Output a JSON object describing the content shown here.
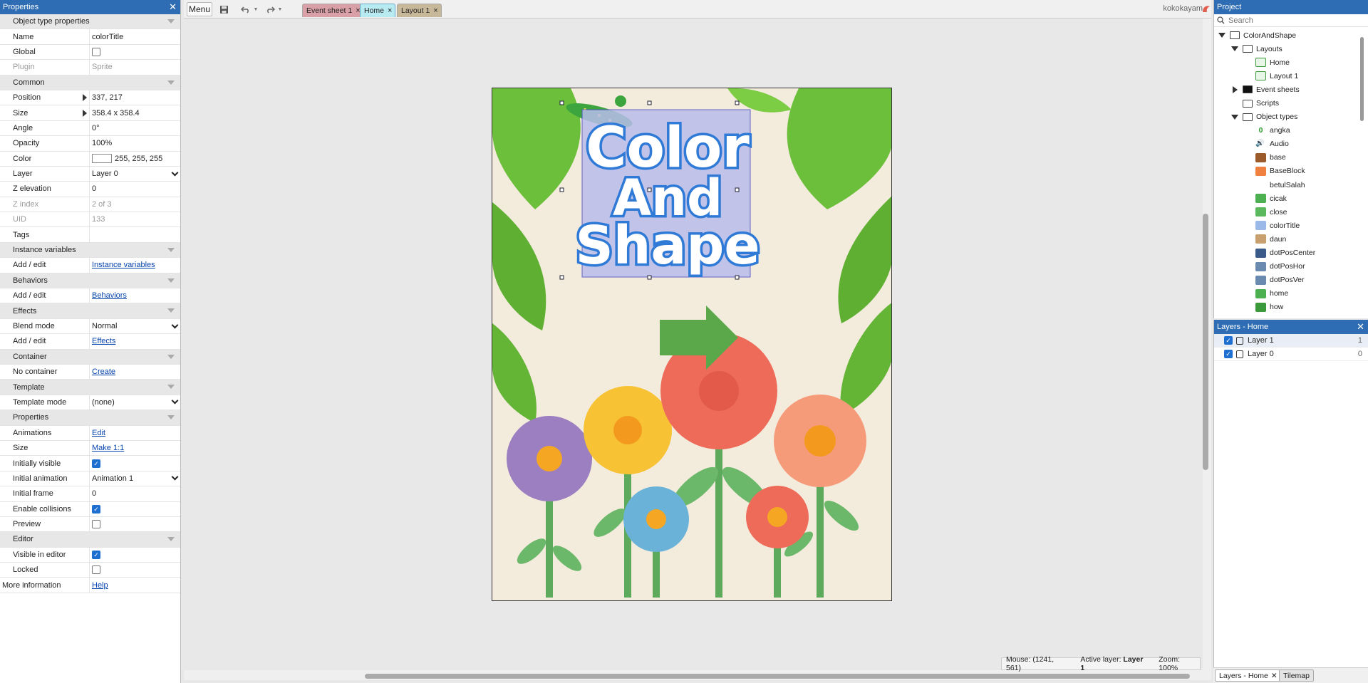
{
  "properties_panel": {
    "title": "Properties",
    "close_glyph": "✕",
    "rows": [
      {
        "type": "section",
        "label": "Object type properties"
      },
      {
        "type": "text",
        "label": "Name",
        "value": "colorTitle"
      },
      {
        "type": "check",
        "label": "Global",
        "checked": false
      },
      {
        "type": "text",
        "label": "Plugin",
        "value": "Sprite",
        "dim": true
      },
      {
        "type": "section",
        "label": "Common"
      },
      {
        "type": "text",
        "label": "Position",
        "value": "337, 217",
        "expander": true
      },
      {
        "type": "text",
        "label": "Size",
        "value": "358.4 x 358.4",
        "expander": true
      },
      {
        "type": "text",
        "label": "Angle",
        "value": "0°"
      },
      {
        "type": "text",
        "label": "Opacity",
        "value": "100%"
      },
      {
        "type": "color",
        "label": "Color",
        "value": "255, 255, 255"
      },
      {
        "type": "select",
        "label": "Layer",
        "value": "Layer 0"
      },
      {
        "type": "text",
        "label": "Z elevation",
        "value": "0"
      },
      {
        "type": "text",
        "label": "Z index",
        "value": "2 of 3",
        "dim": true
      },
      {
        "type": "text",
        "label": "UID",
        "value": "133",
        "dim": true
      },
      {
        "type": "text",
        "label": "Tags",
        "value": ""
      },
      {
        "type": "section",
        "label": "Instance variables"
      },
      {
        "type": "link",
        "label": "Add / edit",
        "value": "Instance variables"
      },
      {
        "type": "section",
        "label": "Behaviors"
      },
      {
        "type": "link",
        "label": "Add / edit",
        "value": "Behaviors"
      },
      {
        "type": "section",
        "label": "Effects"
      },
      {
        "type": "select",
        "label": "Blend mode",
        "value": "Normal"
      },
      {
        "type": "link",
        "label": "Add / edit",
        "value": "Effects"
      },
      {
        "type": "section",
        "label": "Container"
      },
      {
        "type": "link",
        "label": "No container",
        "value": "Create"
      },
      {
        "type": "section",
        "label": "Template"
      },
      {
        "type": "select",
        "label": "Template mode",
        "value": "(none)"
      },
      {
        "type": "section",
        "label": "Properties"
      },
      {
        "type": "link",
        "label": "Animations",
        "value": "Edit"
      },
      {
        "type": "link",
        "label": "Size",
        "value": "Make 1:1"
      },
      {
        "type": "check",
        "label": "Initially visible",
        "checked": true
      },
      {
        "type": "select",
        "label": "Initial animation",
        "value": "Animation 1"
      },
      {
        "type": "text",
        "label": "Initial frame",
        "value": "0"
      },
      {
        "type": "check",
        "label": "Enable collisions",
        "checked": true
      },
      {
        "type": "check",
        "label": "Preview",
        "checked": false
      },
      {
        "type": "section",
        "label": "Editor"
      },
      {
        "type": "check",
        "label": "Visible in editor",
        "checked": true
      },
      {
        "type": "check",
        "label": "Locked",
        "checked": false
      },
      {
        "type": "link",
        "label": "More information",
        "value": "Help",
        "top": true
      }
    ]
  },
  "toolbar": {
    "menu_label": "Menu",
    "save_icon": "save-icon",
    "undo_icon": "undo-icon",
    "redo_icon": "redo-icon",
    "play_icon": "play-icon",
    "tabs": [
      {
        "label": "Event sheet 1",
        "color": "#d9a0a8",
        "active": false
      },
      {
        "label": "Home",
        "color": "#b8eaf2",
        "active": true
      },
      {
        "label": "Layout 1",
        "color": "#c8b89a",
        "active": false
      }
    ],
    "tab_close_glyph": "×",
    "user": "kokokayam"
  },
  "canvas": {
    "title_lines": [
      "Color",
      "And",
      "Shape"
    ],
    "background_color": "#f3ebdc"
  },
  "statusbar": {
    "mouse": "Mouse: (1241, 561)",
    "active_layer_label": "Active layer:",
    "active_layer_value": "Layer 1",
    "zoom": "Zoom: 100%"
  },
  "project_panel": {
    "title": "Project",
    "close_glyph": "✕",
    "search_placeholder": "Search",
    "tree": [
      {
        "label": "ColorAndShape",
        "indent": 0,
        "arrow": "open",
        "icon": "folder"
      },
      {
        "label": "Layouts",
        "indent": 1,
        "arrow": "open",
        "icon": "folder"
      },
      {
        "label": "Home",
        "indent": 2,
        "icon": "layout"
      },
      {
        "label": "Layout 1",
        "indent": 2,
        "icon": "layout"
      },
      {
        "label": "Event sheets",
        "indent": 1,
        "arrow": "closed",
        "icon": "folder-black"
      },
      {
        "label": "Scripts",
        "indent": 1,
        "icon": "folder"
      },
      {
        "label": "Object types",
        "indent": 1,
        "arrow": "open",
        "icon": "folder"
      },
      {
        "label": "angka",
        "indent": 2,
        "icon": "text",
        "color": "#2a9a2a"
      },
      {
        "label": "Audio",
        "indent": 2,
        "icon": "audio",
        "color": "#3870c0"
      },
      {
        "label": "base",
        "indent": 2,
        "icon": "sprite",
        "color": "#9a5a2a"
      },
      {
        "label": "BaseBlock",
        "indent": 2,
        "icon": "sprite",
        "color": "#f08040"
      },
      {
        "label": "betulSalah",
        "indent": 2,
        "icon": "none",
        "color": "#ffffff"
      },
      {
        "label": "cicak",
        "indent": 2,
        "icon": "sprite",
        "color": "#4caf50"
      },
      {
        "label": "close",
        "indent": 2,
        "icon": "sprite",
        "color": "#5cb85c"
      },
      {
        "label": "colorTitle",
        "indent": 2,
        "icon": "sprite",
        "color": "#9ab8e8"
      },
      {
        "label": "daun",
        "indent": 2,
        "icon": "sprite",
        "color": "#c8a070"
      },
      {
        "label": "dotPosCenter",
        "indent": 2,
        "icon": "sprite",
        "color": "#3a5a8a"
      },
      {
        "label": "dotPosHor",
        "indent": 2,
        "icon": "sprite",
        "color": "#6a8ab0"
      },
      {
        "label": "dotPosVer",
        "indent": 2,
        "icon": "sprite",
        "color": "#6a8ab0"
      },
      {
        "label": "home",
        "indent": 2,
        "icon": "sprite",
        "color": "#4caf50"
      },
      {
        "label": "how",
        "indent": 2,
        "icon": "sprite",
        "color": "#3a9a3a"
      }
    ]
  },
  "layers_panel": {
    "title": "Layers - Home",
    "close_glyph": "✕",
    "layers": [
      {
        "name": "Layer 1",
        "index": "1",
        "visible": true
      },
      {
        "name": "Layer 0",
        "index": "0",
        "visible": true
      }
    ],
    "bottom_tabs": [
      {
        "label": "Layers - Home",
        "active": true
      },
      {
        "label": "Tilemap",
        "active": false
      }
    ]
  }
}
